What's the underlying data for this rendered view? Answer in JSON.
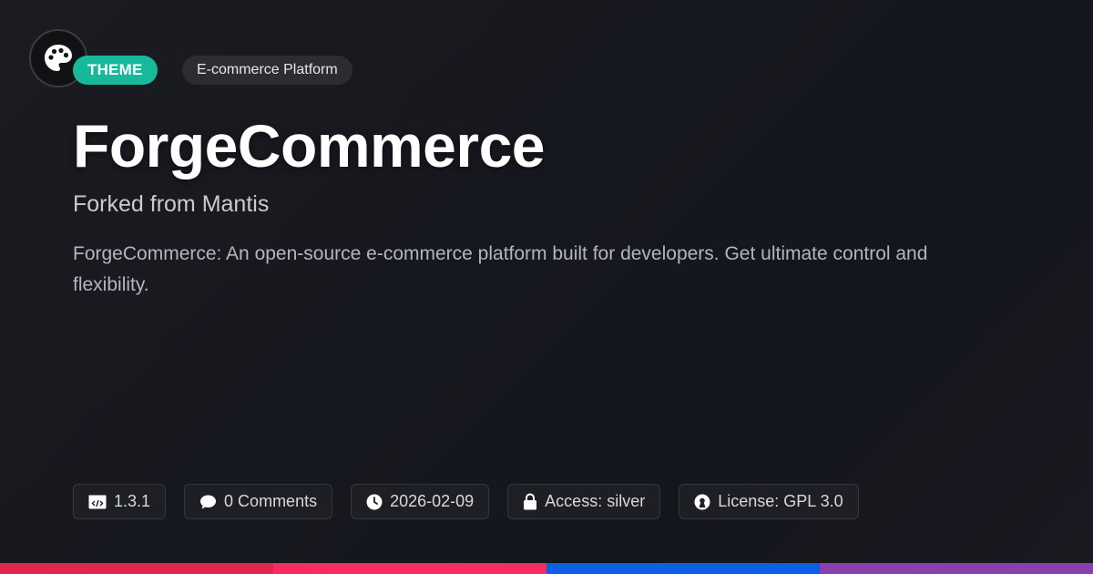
{
  "header": {
    "theme_badge": "THEME",
    "category_badge": "E-commerce Platform"
  },
  "main": {
    "title": "ForgeCommerce",
    "subtitle": "Forked from Mantis",
    "description": "ForgeCommerce: An open-source e-commerce platform built for developers. Get ultimate control and flexibility."
  },
  "meta": {
    "version": "1.3.1",
    "comments": "0 Comments",
    "date": "2026-02-09",
    "access": "Access: silver",
    "license": "License: GPL 3.0"
  },
  "icons": {
    "logo": "palette-icon",
    "version": "code-icon",
    "comments": "comment-icon",
    "date": "clock-icon",
    "access": "lock-icon",
    "license": "open-source-icon"
  },
  "colors": {
    "theme_badge": "#17b99a",
    "bar_1": "#e0264f",
    "bar_2": "#f72d62",
    "bar_3": "#0a5fe6",
    "bar_4": "#8a3fb0"
  }
}
